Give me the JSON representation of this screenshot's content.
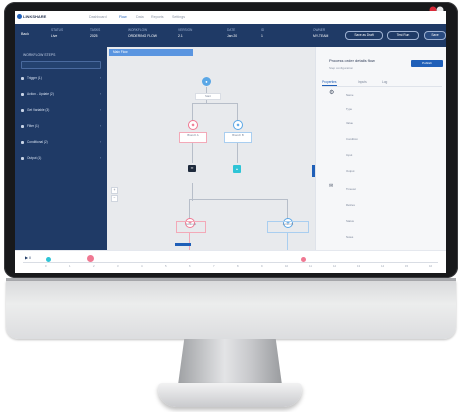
{
  "nav": {
    "brand": "LINKSHARE",
    "items": [
      "Dashboard",
      "Flow",
      "Data",
      "Reports",
      "Settings"
    ]
  },
  "header": {
    "back": "Back",
    "fields": [
      {
        "label": "STATUS",
        "value": "Live"
      },
      {
        "label": "TASKS",
        "value": "2025"
      },
      {
        "label": "WORKFLOW",
        "value": "ORDERING FLOW"
      },
      {
        "label": "VERSION",
        "value": "2.1"
      },
      {
        "label": "DATE",
        "value": "Jan 20"
      },
      {
        "label": "ID",
        "value": "1"
      },
      {
        "label": "OWNER",
        "value": "MY-TEAM"
      }
    ],
    "buttons": [
      "Save as Draft",
      "Test Run",
      "Save"
    ]
  },
  "sidebar": {
    "title": "WORKFLOW STEPS",
    "items": [
      "Trigger (1)",
      "Action - Update (2)",
      "Get Variable (3)",
      "Filter (1)",
      "Conditional (2)",
      "Output (1)"
    ]
  },
  "canvas": {
    "tab": "Main Flow",
    "nodes": [
      "Start",
      "Branch A",
      "Branch B",
      "Condition",
      "Action A",
      "Action B"
    ]
  },
  "panel": {
    "title": "Process order details flow",
    "subtitle": "Step configuration",
    "button": "Publish",
    "tabs": [
      "Properties",
      "Inputs",
      "Log"
    ],
    "rows": [
      "Name",
      "Type",
      "Value",
      "Condition",
      "Input",
      "Output",
      "Timeout",
      "Retries",
      "Status",
      "Notes"
    ]
  },
  "timeline": {
    "marks": [
      "0",
      "1",
      "2",
      "3",
      "4",
      "5",
      "6",
      "7",
      "8",
      "9",
      "10",
      "11",
      "12",
      "13",
      "14",
      "15",
      "16"
    ]
  },
  "colors": {
    "navy": "#1f3a66",
    "accent": "#1f5fb8",
    "node_pink": "#f07892",
    "node_blue": "#5aa7e6",
    "node_cyan": "#2ec4d6"
  }
}
